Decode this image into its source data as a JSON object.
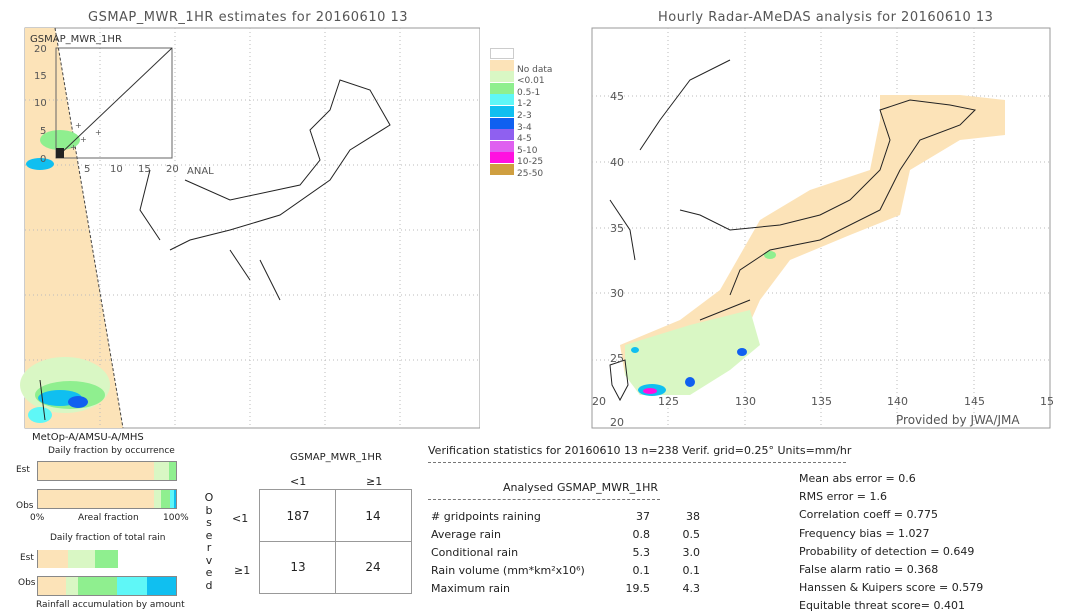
{
  "left_map": {
    "title": "GSMAP_MWR_1HR estimates for 20160610 13",
    "inset_label": "GSMAP_MWR_1HR",
    "inset_xlabel": "ANAL",
    "inset_ticks": [
      "0",
      "5",
      "10",
      "15",
      "20"
    ],
    "sensor_label": "MetOp-A/AMSU-A/MHS"
  },
  "right_map": {
    "title": "Hourly Radar-AMeDAS analysis for 20160610 13",
    "lon_ticks": [
      "20",
      "125",
      "130",
      "135",
      "140",
      "145",
      "15"
    ],
    "lat_ticks": [
      "45",
      "40",
      "35",
      "30",
      "25",
      "20"
    ],
    "credit": "Provided by JWA/JMA"
  },
  "legend": [
    {
      "label": "",
      "color": "#ffffff"
    },
    {
      "label": "No data",
      "color": "#fce3b8"
    },
    {
      "label": "<0.01",
      "color": "#d9f7c4"
    },
    {
      "label": "0.5-1",
      "color": "#8fef8f"
    },
    {
      "label": "1-2",
      "color": "#5ff7f7"
    },
    {
      "label": "2-3",
      "color": "#10bff0"
    },
    {
      "label": "3-4",
      "color": "#1060f0"
    },
    {
      "label": "4-5",
      "color": "#8f60f0"
    },
    {
      "label": "5-10",
      "color": "#df60f0"
    },
    {
      "label": "10-25",
      "color": "#ff10e0"
    },
    {
      "label": "25-50",
      "color": "#cf9f40"
    }
  ],
  "fraction_charts": {
    "occurrence_title": "Daily fraction by occurrence",
    "total_title": "Daily fraction of total rain",
    "accum_title": "Rainfall accumulation by amount",
    "est_label": "Est",
    "obs_label": "Obs",
    "axis_left": "0%",
    "axis_mid": "Areal fraction",
    "axis_right": "100%",
    "occurrence_est": [
      {
        "frac": 0.84,
        "color": "#fce3b8"
      },
      {
        "frac": 0.11,
        "color": "#d9f7c4"
      },
      {
        "frac": 0.05,
        "color": "#8fef8f"
      }
    ],
    "occurrence_obs": [
      {
        "frac": 0.84,
        "color": "#fce3b8"
      },
      {
        "frac": 0.05,
        "color": "#d9f7c4"
      },
      {
        "frac": 0.065,
        "color": "#8fef8f"
      },
      {
        "frac": 0.03,
        "color": "#5ff7f7"
      },
      {
        "frac": 0.015,
        "color": "#10bff0"
      }
    ],
    "total_est": [
      {
        "frac": 0.22,
        "color": "#fce3b8"
      },
      {
        "frac": 0.19,
        "color": "#d9f7c4"
      },
      {
        "frac": 0.17,
        "color": "#8fef8f"
      }
    ],
    "total_obs": [
      {
        "frac": 0.2,
        "color": "#fce3b8"
      },
      {
        "frac": 0.09,
        "color": "#d9f7c4"
      },
      {
        "frac": 0.28,
        "color": "#8fef8f"
      },
      {
        "frac": 0.22,
        "color": "#5ff7f7"
      },
      {
        "frac": 0.21,
        "color": "#10bff0"
      }
    ]
  },
  "contingency": {
    "title": "GSMAP_MWR_1HR",
    "col_headers": [
      "<1",
      "≥1"
    ],
    "row_headers": [
      "<1",
      "≥1"
    ],
    "side_label": [
      "O",
      "b",
      "s",
      "e",
      "r",
      "v",
      "e",
      "d"
    ],
    "cells": [
      [
        "187",
        "14"
      ],
      [
        "13",
        "24"
      ]
    ]
  },
  "stats": {
    "header": "Verification statistics for 20160610 13  n=238  Verif. grid=0.25°  Units=mm/hr",
    "col_analysed": "Analysed",
    "col_est": "GSMAP_MWR_1HR",
    "rows": [
      {
        "label": "# gridpoints raining",
        "analysed": "37",
        "est": "38"
      },
      {
        "label": "Average rain",
        "analysed": "0.8",
        "est": "0.5"
      },
      {
        "label": "Conditional rain",
        "analysed": "5.3",
        "est": "3.0"
      },
      {
        "label": "Rain volume (mm*km²x10⁶)",
        "analysed": "0.1",
        "est": "0.1"
      },
      {
        "label": "Maximum rain",
        "analysed": "19.5",
        "est": "4.3"
      }
    ],
    "scores": [
      "Mean abs error = 0.6",
      "RMS error = 1.6",
      "Correlation coeff = 0.775",
      "Frequency bias = 1.027",
      "Probability of detection = 0.649",
      "False alarm ratio = 0.368",
      "Hanssen & Kuipers score = 0.579",
      "Equitable threat score= 0.401"
    ]
  },
  "chart_data": {
    "type": "table",
    "contingency_table": {
      "rows_observed": [
        "<1",
        "≥1"
      ],
      "cols_estimated": [
        "<1",
        "≥1"
      ],
      "values": [
        [
          187,
          14
        ],
        [
          13,
          24
        ]
      ]
    },
    "n": 238
  }
}
